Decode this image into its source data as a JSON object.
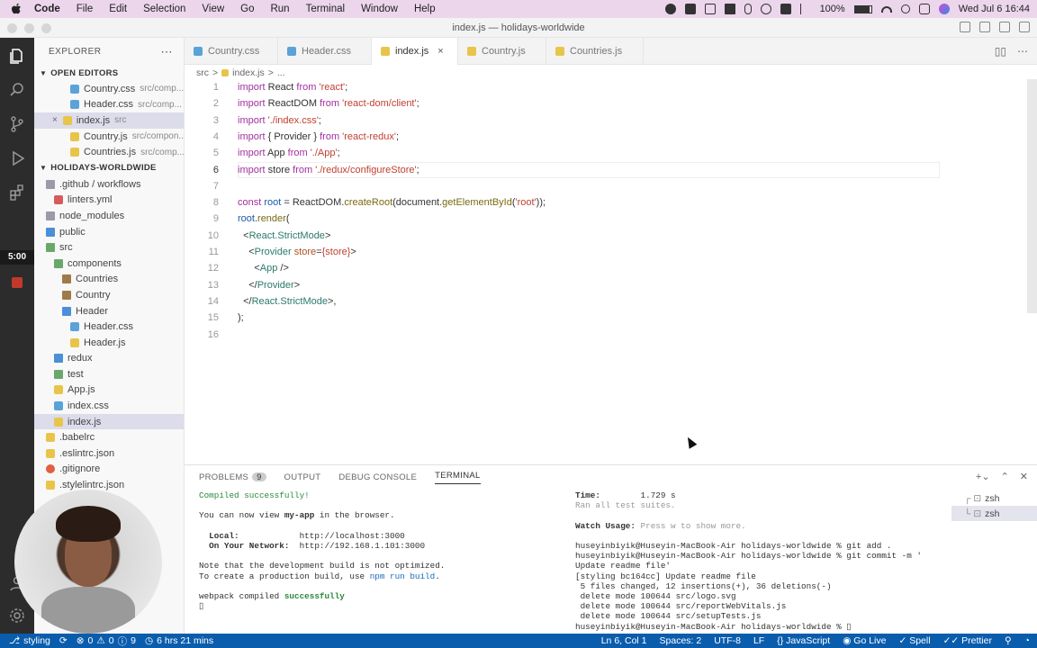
{
  "menubar": {
    "app": "Code",
    "items": [
      "File",
      "Edit",
      "Selection",
      "View",
      "Go",
      "Run",
      "Terminal",
      "Window",
      "Help"
    ],
    "battery": "100%",
    "datetime": "Wed Jul 6  16:44"
  },
  "window": {
    "title": "index.js — holidays-worldwide"
  },
  "activity": {
    "timer": "5:00"
  },
  "explorer": {
    "title": "EXPLORER",
    "open_editors_label": "OPEN EDITORS",
    "open_editors": [
      {
        "name": "Country.css",
        "path": "src/comp...",
        "icon": "css"
      },
      {
        "name": "Header.css",
        "path": "src/comp...",
        "icon": "css"
      },
      {
        "name": "index.js",
        "path": "src",
        "icon": "js",
        "close": "×"
      },
      {
        "name": "Country.js",
        "path": "src/compon...",
        "icon": "js"
      },
      {
        "name": "Countries.js",
        "path": "src/comp...",
        "icon": "js"
      }
    ],
    "project_label": "HOLIDAYS-WORLDWIDE",
    "tree": [
      {
        "name": ".github / workflows",
        "icon": "folder",
        "indent": 1
      },
      {
        "name": "linters.yml",
        "icon": "yml",
        "indent": 2
      },
      {
        "name": "node_modules",
        "icon": "folder",
        "indent": 1
      },
      {
        "name": "public",
        "icon": "folder",
        "indent": 1
      },
      {
        "name": "src",
        "icon": "folder",
        "indent": 1
      },
      {
        "name": "components",
        "icon": "folder",
        "indent": 2
      },
      {
        "name": "Countries",
        "icon": "folder",
        "indent": 3
      },
      {
        "name": "Country",
        "icon": "folder",
        "indent": 3
      },
      {
        "name": "Header",
        "icon": "folder",
        "indent": 3
      },
      {
        "name": "Header.css",
        "icon": "css",
        "indent": 4
      },
      {
        "name": "Header.js",
        "icon": "js",
        "indent": 4
      },
      {
        "name": "redux",
        "icon": "folder",
        "indent": 2
      },
      {
        "name": "test",
        "icon": "folder",
        "indent": 2
      },
      {
        "name": "App.js",
        "icon": "js",
        "indent": 2
      },
      {
        "name": "index.css",
        "icon": "css",
        "indent": 2
      },
      {
        "name": "index.js",
        "icon": "js",
        "indent": 2,
        "selected": true
      },
      {
        "name": ".babelrc",
        "icon": "babel",
        "indent": 1
      },
      {
        "name": ".eslintrc.json",
        "icon": "json",
        "indent": 1
      },
      {
        "name": ".gitignore",
        "icon": "git",
        "indent": 1
      },
      {
        "name": ".stylelintrc.json",
        "icon": "json",
        "indent": 1
      }
    ]
  },
  "tabs": [
    {
      "label": "Country.css",
      "icon": "css"
    },
    {
      "label": "Header.css",
      "icon": "css"
    },
    {
      "label": "index.js",
      "icon": "js",
      "active": true,
      "close": "×"
    },
    {
      "label": "Country.js",
      "icon": "js"
    },
    {
      "label": "Countries.js",
      "icon": "js"
    }
  ],
  "breadcrumb": [
    "src",
    ">",
    "index.js",
    ">",
    "..."
  ],
  "editor": {
    "line_numbers": [
      "1",
      "2",
      "3",
      "4",
      "5",
      "6",
      "7",
      "8",
      "9",
      "10",
      "11",
      "12",
      "13",
      "14",
      "15",
      "16"
    ],
    "current_line": 6
  },
  "panel": {
    "tabs": [
      "PROBLEMS",
      "OUTPUT",
      "DEBUG CONSOLE",
      "TERMINAL"
    ],
    "problems_count": "9",
    "terminals": [
      "zsh",
      "zsh"
    ],
    "left_terminal": {
      "compiled": "Compiled successfully!",
      "view_pre": "You can now view ",
      "app_name": "my-app",
      "view_post": " in the browser.",
      "local_label": "  Local:",
      "local_url": "http://localhost:3000",
      "network_label": "  On Your Network:",
      "network_url": "http://192.168.1.101:3000",
      "note1": "Note that the development build is not optimized.",
      "note2_pre": "To create a production build, use ",
      "note2_cmd": "npm run build",
      "note2_post": ".",
      "webpack_pre": "webpack compiled ",
      "webpack_status": "successfully"
    },
    "right_terminal": {
      "time_label": "Time:",
      "time_value": "1.729 s",
      "ran": "Ran all test suites.",
      "watch_label": "Watch Usage:",
      "watch_text": " Press w to show more.",
      "lines": [
        "huseyinbiyik@Huseyin-MacBook-Air holidays-worldwide % git add .",
        "huseyinbiyik@Huseyin-MacBook-Air holidays-worldwide % git commit -m '",
        "Update readme file'",
        "[styling bc164cc] Update readme file",
        " 5 files changed, 12 insertions(+), 36 deletions(-)",
        " delete mode 100644 src/logo.svg",
        " delete mode 100644 src/reportWebVitals.js",
        " delete mode 100644 src/setupTests.js",
        "huseyinbiyik@Huseyin-MacBook-Air holidays-worldwide % "
      ]
    }
  },
  "statusbar": {
    "branch": "styling",
    "errors": "0",
    "warnings": "0",
    "info": "9",
    "time_tracked": "6 hrs 21 mins",
    "position": "Ln 6, Col 1",
    "spaces": "Spaces: 2",
    "encoding": "UTF-8",
    "eol": "LF",
    "language": "JavaScript",
    "golive": "Go Live",
    "spell": "Spell",
    "prettier": "Prettier"
  }
}
